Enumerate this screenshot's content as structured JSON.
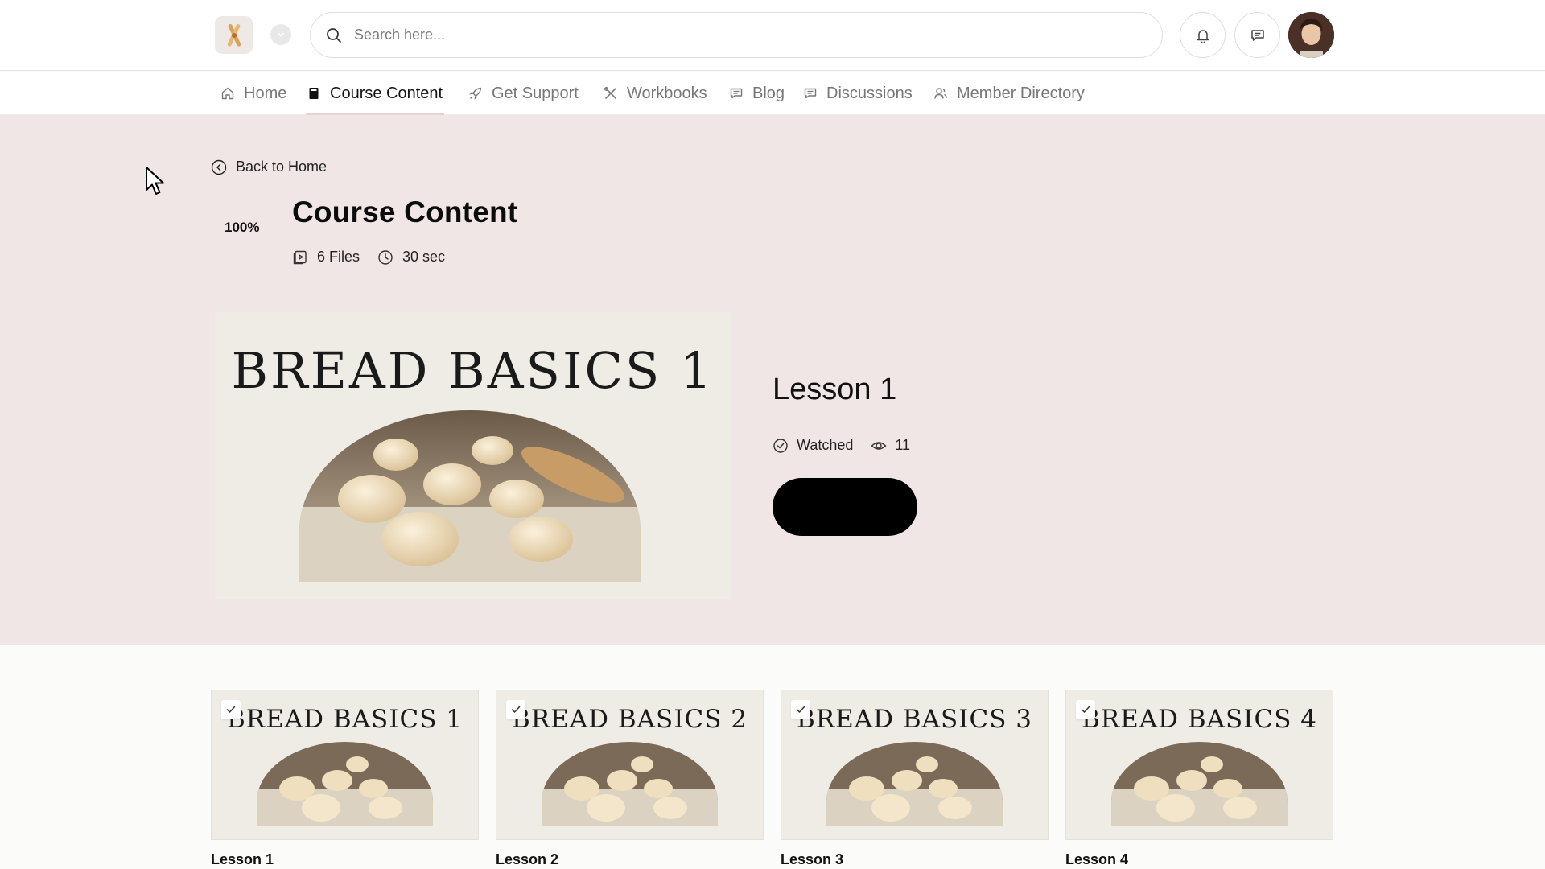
{
  "header": {
    "search_placeholder": "Search here..."
  },
  "nav": {
    "items": [
      {
        "label": "Home",
        "icon": "home-icon"
      },
      {
        "label": "Course Content",
        "icon": "book-icon",
        "active": true
      },
      {
        "label": "Get Support",
        "icon": "rocket-icon"
      },
      {
        "label": "Workbooks",
        "icon": "tools-icon"
      },
      {
        "label": "Blog",
        "icon": "chat-lines-icon"
      },
      {
        "label": "Discussions",
        "icon": "chat-lines-icon"
      },
      {
        "label": "Member Directory",
        "icon": "members-icon"
      }
    ]
  },
  "hero": {
    "back_label": "Back to Home",
    "progress": "100%",
    "title": "Course Content",
    "files": "6 Files",
    "duration": "30 sec",
    "feature_image_title": "BREAD BASICS 1",
    "lesson_title": "Lesson 1",
    "watched_label": "Watched",
    "views": "11"
  },
  "lessons": [
    {
      "thumb_title": "BREAD BASICS 1",
      "label": "Lesson 1",
      "watched": true
    },
    {
      "thumb_title": "BREAD BASICS 2",
      "label": "Lesson 2",
      "watched": true
    },
    {
      "thumb_title": "BREAD BASICS 3",
      "label": "Lesson 3",
      "watched": true
    },
    {
      "thumb_title": "BREAD BASICS 4",
      "label": "Lesson 4",
      "watched": true
    }
  ],
  "colors": {
    "hero_bg": "#f1e6e6",
    "page_bg": "#fbfbfa",
    "primary_button": "#000000"
  }
}
